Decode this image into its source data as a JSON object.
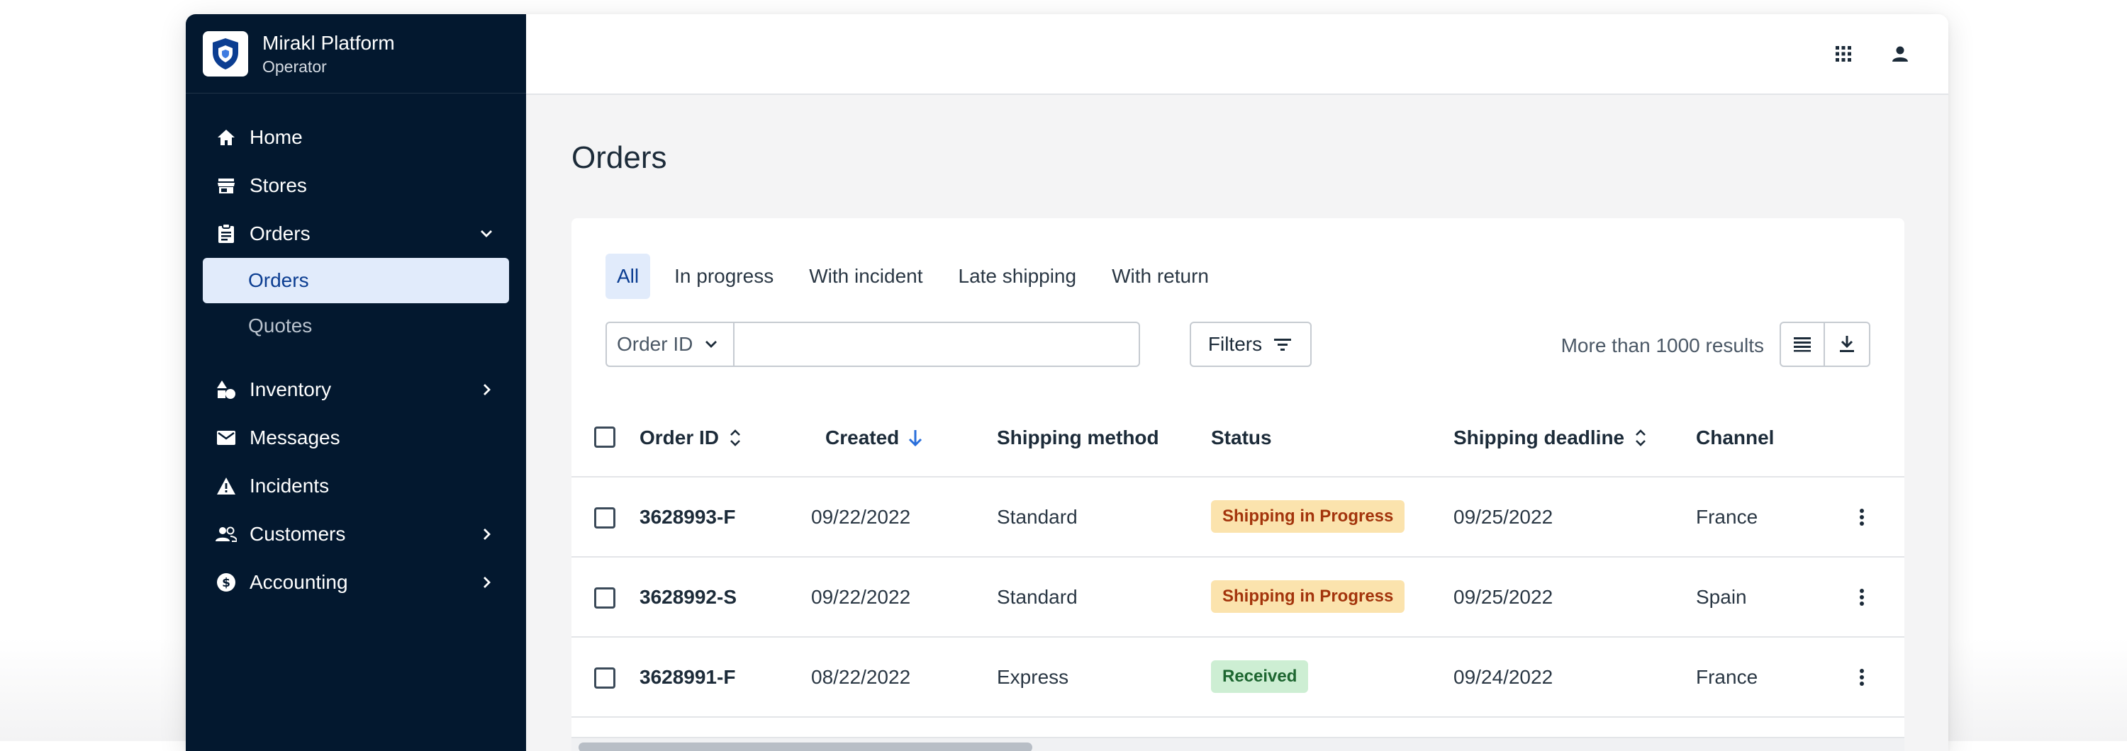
{
  "brand": {
    "name": "Mirakl Platform",
    "role": "Operator"
  },
  "sidebar": {
    "items": [
      {
        "label": "Home",
        "icon": "home-icon"
      },
      {
        "label": "Stores",
        "icon": "store-icon"
      },
      {
        "label": "Orders",
        "icon": "clipboard-icon",
        "expanded": true,
        "children": [
          {
            "label": "Orders",
            "active": true
          },
          {
            "label": "Quotes"
          }
        ]
      },
      {
        "label": "Inventory",
        "icon": "shapes-icon"
      },
      {
        "label": "Messages",
        "icon": "mail-icon"
      },
      {
        "label": "Incidents",
        "icon": "warning-icon"
      },
      {
        "label": "Customers",
        "icon": "people-icon"
      },
      {
        "label": "Accounting",
        "icon": "dollar-icon"
      }
    ]
  },
  "topbar": {
    "icons": [
      "apps-grid-icon",
      "user-icon"
    ]
  },
  "page": {
    "title": "Orders"
  },
  "tabs": [
    {
      "label": "All",
      "active": true
    },
    {
      "label": "In progress"
    },
    {
      "label": "With incident"
    },
    {
      "label": "Late shipping"
    },
    {
      "label": "With return"
    }
  ],
  "search": {
    "field_label": "Order ID",
    "value": "",
    "placeholder": ""
  },
  "filters": {
    "label": "Filters"
  },
  "results": {
    "text": "More than 1000 results"
  },
  "table": {
    "columns": [
      "Order ID",
      "Created",
      "Shipping method",
      "Status",
      "Shipping deadline",
      "Channel"
    ],
    "rows": [
      {
        "id": "3628993-F",
        "created": "09/22/2022",
        "method": "Standard",
        "status": "Shipping in Progress",
        "deadline": "09/25/2022",
        "channel": "France"
      },
      {
        "id": "3628992-S",
        "created": "09/22/2022",
        "method": "Standard",
        "status": "Shipping in Progress",
        "deadline": "09/25/2022",
        "channel": "Spain"
      },
      {
        "id": "3628991-F",
        "created": "08/22/2022",
        "method": "Express",
        "status": "Received",
        "deadline": "09/24/2022",
        "channel": "France"
      }
    ]
  },
  "colors": {
    "sidebar_bg": "#03182f",
    "accent": "#0b3d91",
    "active_bg": "#e1ebfb",
    "status_progress_bg": "#fbe3ad",
    "status_progress_text": "#a3340c",
    "status_received_bg": "#cdeed3",
    "status_received_text": "#1d6630"
  }
}
